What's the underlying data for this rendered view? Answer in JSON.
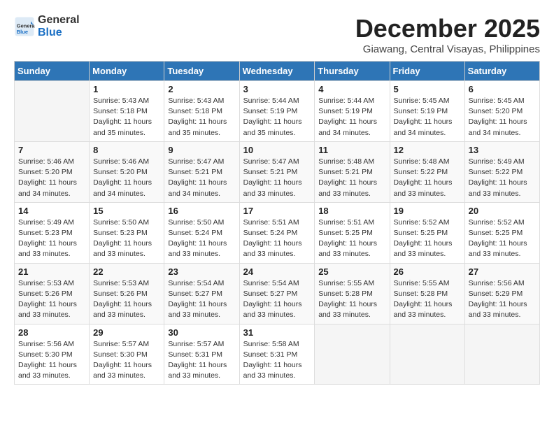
{
  "header": {
    "logo_general": "General",
    "logo_blue": "Blue",
    "month_title": "December 2025",
    "subtitle": "Giawang, Central Visayas, Philippines"
  },
  "weekdays": [
    "Sunday",
    "Monday",
    "Tuesday",
    "Wednesday",
    "Thursday",
    "Friday",
    "Saturday"
  ],
  "weeks": [
    [
      {
        "day": "",
        "info": ""
      },
      {
        "day": "1",
        "info": "Sunrise: 5:43 AM\nSunset: 5:18 PM\nDaylight: 11 hours\nand 35 minutes."
      },
      {
        "day": "2",
        "info": "Sunrise: 5:43 AM\nSunset: 5:18 PM\nDaylight: 11 hours\nand 35 minutes."
      },
      {
        "day": "3",
        "info": "Sunrise: 5:44 AM\nSunset: 5:19 PM\nDaylight: 11 hours\nand 35 minutes."
      },
      {
        "day": "4",
        "info": "Sunrise: 5:44 AM\nSunset: 5:19 PM\nDaylight: 11 hours\nand 34 minutes."
      },
      {
        "day": "5",
        "info": "Sunrise: 5:45 AM\nSunset: 5:19 PM\nDaylight: 11 hours\nand 34 minutes."
      },
      {
        "day": "6",
        "info": "Sunrise: 5:45 AM\nSunset: 5:20 PM\nDaylight: 11 hours\nand 34 minutes."
      }
    ],
    [
      {
        "day": "7",
        "info": "Sunrise: 5:46 AM\nSunset: 5:20 PM\nDaylight: 11 hours\nand 34 minutes."
      },
      {
        "day": "8",
        "info": "Sunrise: 5:46 AM\nSunset: 5:20 PM\nDaylight: 11 hours\nand 34 minutes."
      },
      {
        "day": "9",
        "info": "Sunrise: 5:47 AM\nSunset: 5:21 PM\nDaylight: 11 hours\nand 34 minutes."
      },
      {
        "day": "10",
        "info": "Sunrise: 5:47 AM\nSunset: 5:21 PM\nDaylight: 11 hours\nand 33 minutes."
      },
      {
        "day": "11",
        "info": "Sunrise: 5:48 AM\nSunset: 5:21 PM\nDaylight: 11 hours\nand 33 minutes."
      },
      {
        "day": "12",
        "info": "Sunrise: 5:48 AM\nSunset: 5:22 PM\nDaylight: 11 hours\nand 33 minutes."
      },
      {
        "day": "13",
        "info": "Sunrise: 5:49 AM\nSunset: 5:22 PM\nDaylight: 11 hours\nand 33 minutes."
      }
    ],
    [
      {
        "day": "14",
        "info": "Sunrise: 5:49 AM\nSunset: 5:23 PM\nDaylight: 11 hours\nand 33 minutes."
      },
      {
        "day": "15",
        "info": "Sunrise: 5:50 AM\nSunset: 5:23 PM\nDaylight: 11 hours\nand 33 minutes."
      },
      {
        "day": "16",
        "info": "Sunrise: 5:50 AM\nSunset: 5:24 PM\nDaylight: 11 hours\nand 33 minutes."
      },
      {
        "day": "17",
        "info": "Sunrise: 5:51 AM\nSunset: 5:24 PM\nDaylight: 11 hours\nand 33 minutes."
      },
      {
        "day": "18",
        "info": "Sunrise: 5:51 AM\nSunset: 5:25 PM\nDaylight: 11 hours\nand 33 minutes."
      },
      {
        "day": "19",
        "info": "Sunrise: 5:52 AM\nSunset: 5:25 PM\nDaylight: 11 hours\nand 33 minutes."
      },
      {
        "day": "20",
        "info": "Sunrise: 5:52 AM\nSunset: 5:25 PM\nDaylight: 11 hours\nand 33 minutes."
      }
    ],
    [
      {
        "day": "21",
        "info": "Sunrise: 5:53 AM\nSunset: 5:26 PM\nDaylight: 11 hours\nand 33 minutes."
      },
      {
        "day": "22",
        "info": "Sunrise: 5:53 AM\nSunset: 5:26 PM\nDaylight: 11 hours\nand 33 minutes."
      },
      {
        "day": "23",
        "info": "Sunrise: 5:54 AM\nSunset: 5:27 PM\nDaylight: 11 hours\nand 33 minutes."
      },
      {
        "day": "24",
        "info": "Sunrise: 5:54 AM\nSunset: 5:27 PM\nDaylight: 11 hours\nand 33 minutes."
      },
      {
        "day": "25",
        "info": "Sunrise: 5:55 AM\nSunset: 5:28 PM\nDaylight: 11 hours\nand 33 minutes."
      },
      {
        "day": "26",
        "info": "Sunrise: 5:55 AM\nSunset: 5:28 PM\nDaylight: 11 hours\nand 33 minutes."
      },
      {
        "day": "27",
        "info": "Sunrise: 5:56 AM\nSunset: 5:29 PM\nDaylight: 11 hours\nand 33 minutes."
      }
    ],
    [
      {
        "day": "28",
        "info": "Sunrise: 5:56 AM\nSunset: 5:30 PM\nDaylight: 11 hours\nand 33 minutes."
      },
      {
        "day": "29",
        "info": "Sunrise: 5:57 AM\nSunset: 5:30 PM\nDaylight: 11 hours\nand 33 minutes."
      },
      {
        "day": "30",
        "info": "Sunrise: 5:57 AM\nSunset: 5:31 PM\nDaylight: 11 hours\nand 33 minutes."
      },
      {
        "day": "31",
        "info": "Sunrise: 5:58 AM\nSunset: 5:31 PM\nDaylight: 11 hours\nand 33 minutes."
      },
      {
        "day": "",
        "info": ""
      },
      {
        "day": "",
        "info": ""
      },
      {
        "day": "",
        "info": ""
      }
    ]
  ]
}
